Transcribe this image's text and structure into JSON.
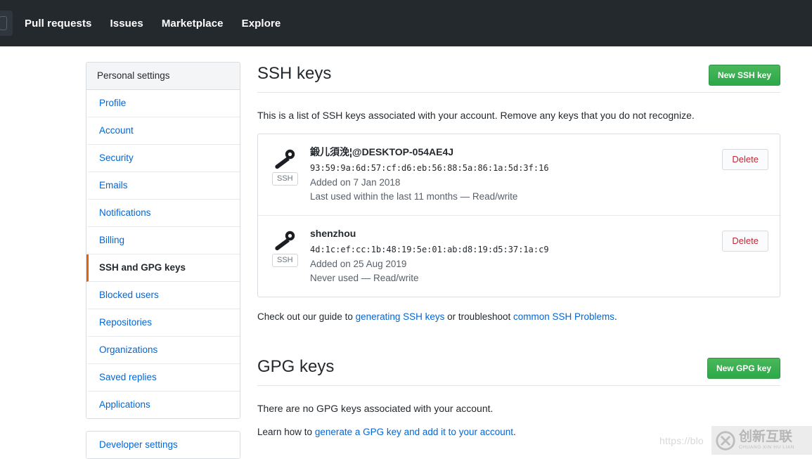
{
  "topnav": {
    "logo_icon": "github-mark-icon",
    "links": [
      {
        "label": "Pull requests",
        "name": "nav-pull-requests"
      },
      {
        "label": "Issues",
        "name": "nav-issues"
      },
      {
        "label": "Marketplace",
        "name": "nav-marketplace"
      },
      {
        "label": "Explore",
        "name": "nav-explore"
      }
    ]
  },
  "sidebar": {
    "heading": "Personal settings",
    "items": [
      {
        "label": "Profile",
        "selected": false
      },
      {
        "label": "Account",
        "selected": false
      },
      {
        "label": "Security",
        "selected": false
      },
      {
        "label": "Emails",
        "selected": false
      },
      {
        "label": "Notifications",
        "selected": false
      },
      {
        "label": "Billing",
        "selected": false
      },
      {
        "label": "SSH and GPG keys",
        "selected": true
      },
      {
        "label": "Blocked users",
        "selected": false
      },
      {
        "label": "Repositories",
        "selected": false
      },
      {
        "label": "Organizations",
        "selected": false
      },
      {
        "label": "Saved replies",
        "selected": false
      },
      {
        "label": "Applications",
        "selected": false
      }
    ],
    "developer_settings": "Developer settings"
  },
  "ssh_section": {
    "title": "SSH keys",
    "new_button": "New SSH key",
    "intro": "This is a list of SSH keys associated with your account. Remove any keys that you do not recognize.",
    "keys": [
      {
        "title": "鍛儿須浼¦@DESKTOP-054AE4J",
        "fingerprint": "93:59:9a:6d:57:cf:d6:eb:56:88:5a:86:1a:5d:3f:16",
        "added": "Added on 7 Jan 2018",
        "usage": "Last used within the last 11 months — Read/write",
        "badge": "SSH",
        "delete_label": "Delete"
      },
      {
        "title": "shenzhou",
        "fingerprint": "4d:1c:ef:cc:1b:48:19:5e:01:ab:d8:19:d5:37:1a:c9",
        "added": "Added on 25 Aug 2019",
        "usage": "Never used — Read/write",
        "badge": "SSH",
        "delete_label": "Delete"
      }
    ],
    "help_prefix": "Check out our guide to ",
    "help_link1": "generating SSH keys",
    "help_middle": " or troubleshoot ",
    "help_link2": "common SSH Problems",
    "help_suffix": "."
  },
  "gpg_section": {
    "title": "GPG keys",
    "new_button": "New GPG key",
    "empty": "There are no GPG keys associated with your account.",
    "learn_prefix": "Learn how to ",
    "learn_link": "generate a GPG key and add it to your account",
    "learn_suffix": "."
  },
  "watermark": {
    "url": "https://blo",
    "brand_cn": "创新互联",
    "brand_en": "CHUANG XIN HU LIAN",
    "logo_icon": "cx-logo-icon"
  },
  "colors": {
    "nav_bg": "#24292e",
    "green_button": "#2eaa4a",
    "link_blue": "#0366d6",
    "delete_red": "#cb2431",
    "active_marker_orange": "#e36209"
  }
}
